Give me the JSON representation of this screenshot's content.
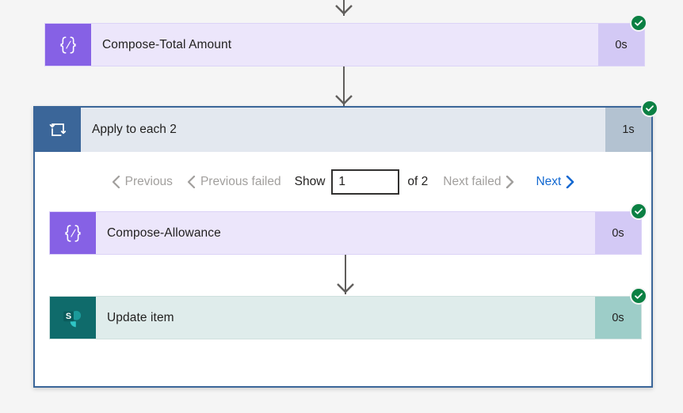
{
  "flow": {
    "steps": [
      {
        "name": "compose-total-amount",
        "title": "Compose-Total Amount",
        "duration": "0s",
        "icon": "compose-braces-icon",
        "status": "succeeded",
        "type": "compose"
      },
      {
        "name": "apply-to-each-2",
        "title": "Apply to each 2",
        "duration": "1s",
        "icon": "loop-icon",
        "status": "succeeded",
        "type": "loop"
      },
      {
        "name": "compose-allowance",
        "title": "Compose-Allowance",
        "duration": "0s",
        "icon": "compose-braces-icon",
        "status": "succeeded",
        "type": "compose"
      },
      {
        "name": "update-item",
        "title": "Update item",
        "duration": "0s",
        "icon": "sharepoint-icon",
        "status": "succeeded",
        "type": "sharepoint"
      }
    ]
  },
  "pager": {
    "previous_label": "Previous",
    "previous_failed_label": "Previous failed",
    "show_label": "Show",
    "page_value": "1",
    "of_label": "of 2",
    "next_failed_label": "Next failed",
    "next_label": "Next"
  },
  "icons": {
    "check": "check-icon",
    "chevron_left": "chevron-left-icon",
    "chevron_right": "chevron-right-icon",
    "arrow_down": "arrow-down-icon"
  },
  "colors": {
    "compose_accent": "#8661e5",
    "compose_body": "#ece6fb",
    "compose_duration": "#d3c9f5",
    "sharepoint_accent": "#0f6b6b",
    "sharepoint_body": "#dfeceb",
    "sharepoint_duration": "#9dcdc8",
    "loop_accent": "#3b6699",
    "loop_header": "#e3e8ef",
    "loop_duration": "#b3c2d1",
    "success_green": "#0b8043",
    "link_blue": "#1268d1",
    "disabled_gray": "#a19f9d",
    "canvas": "#f5f5f5"
  }
}
